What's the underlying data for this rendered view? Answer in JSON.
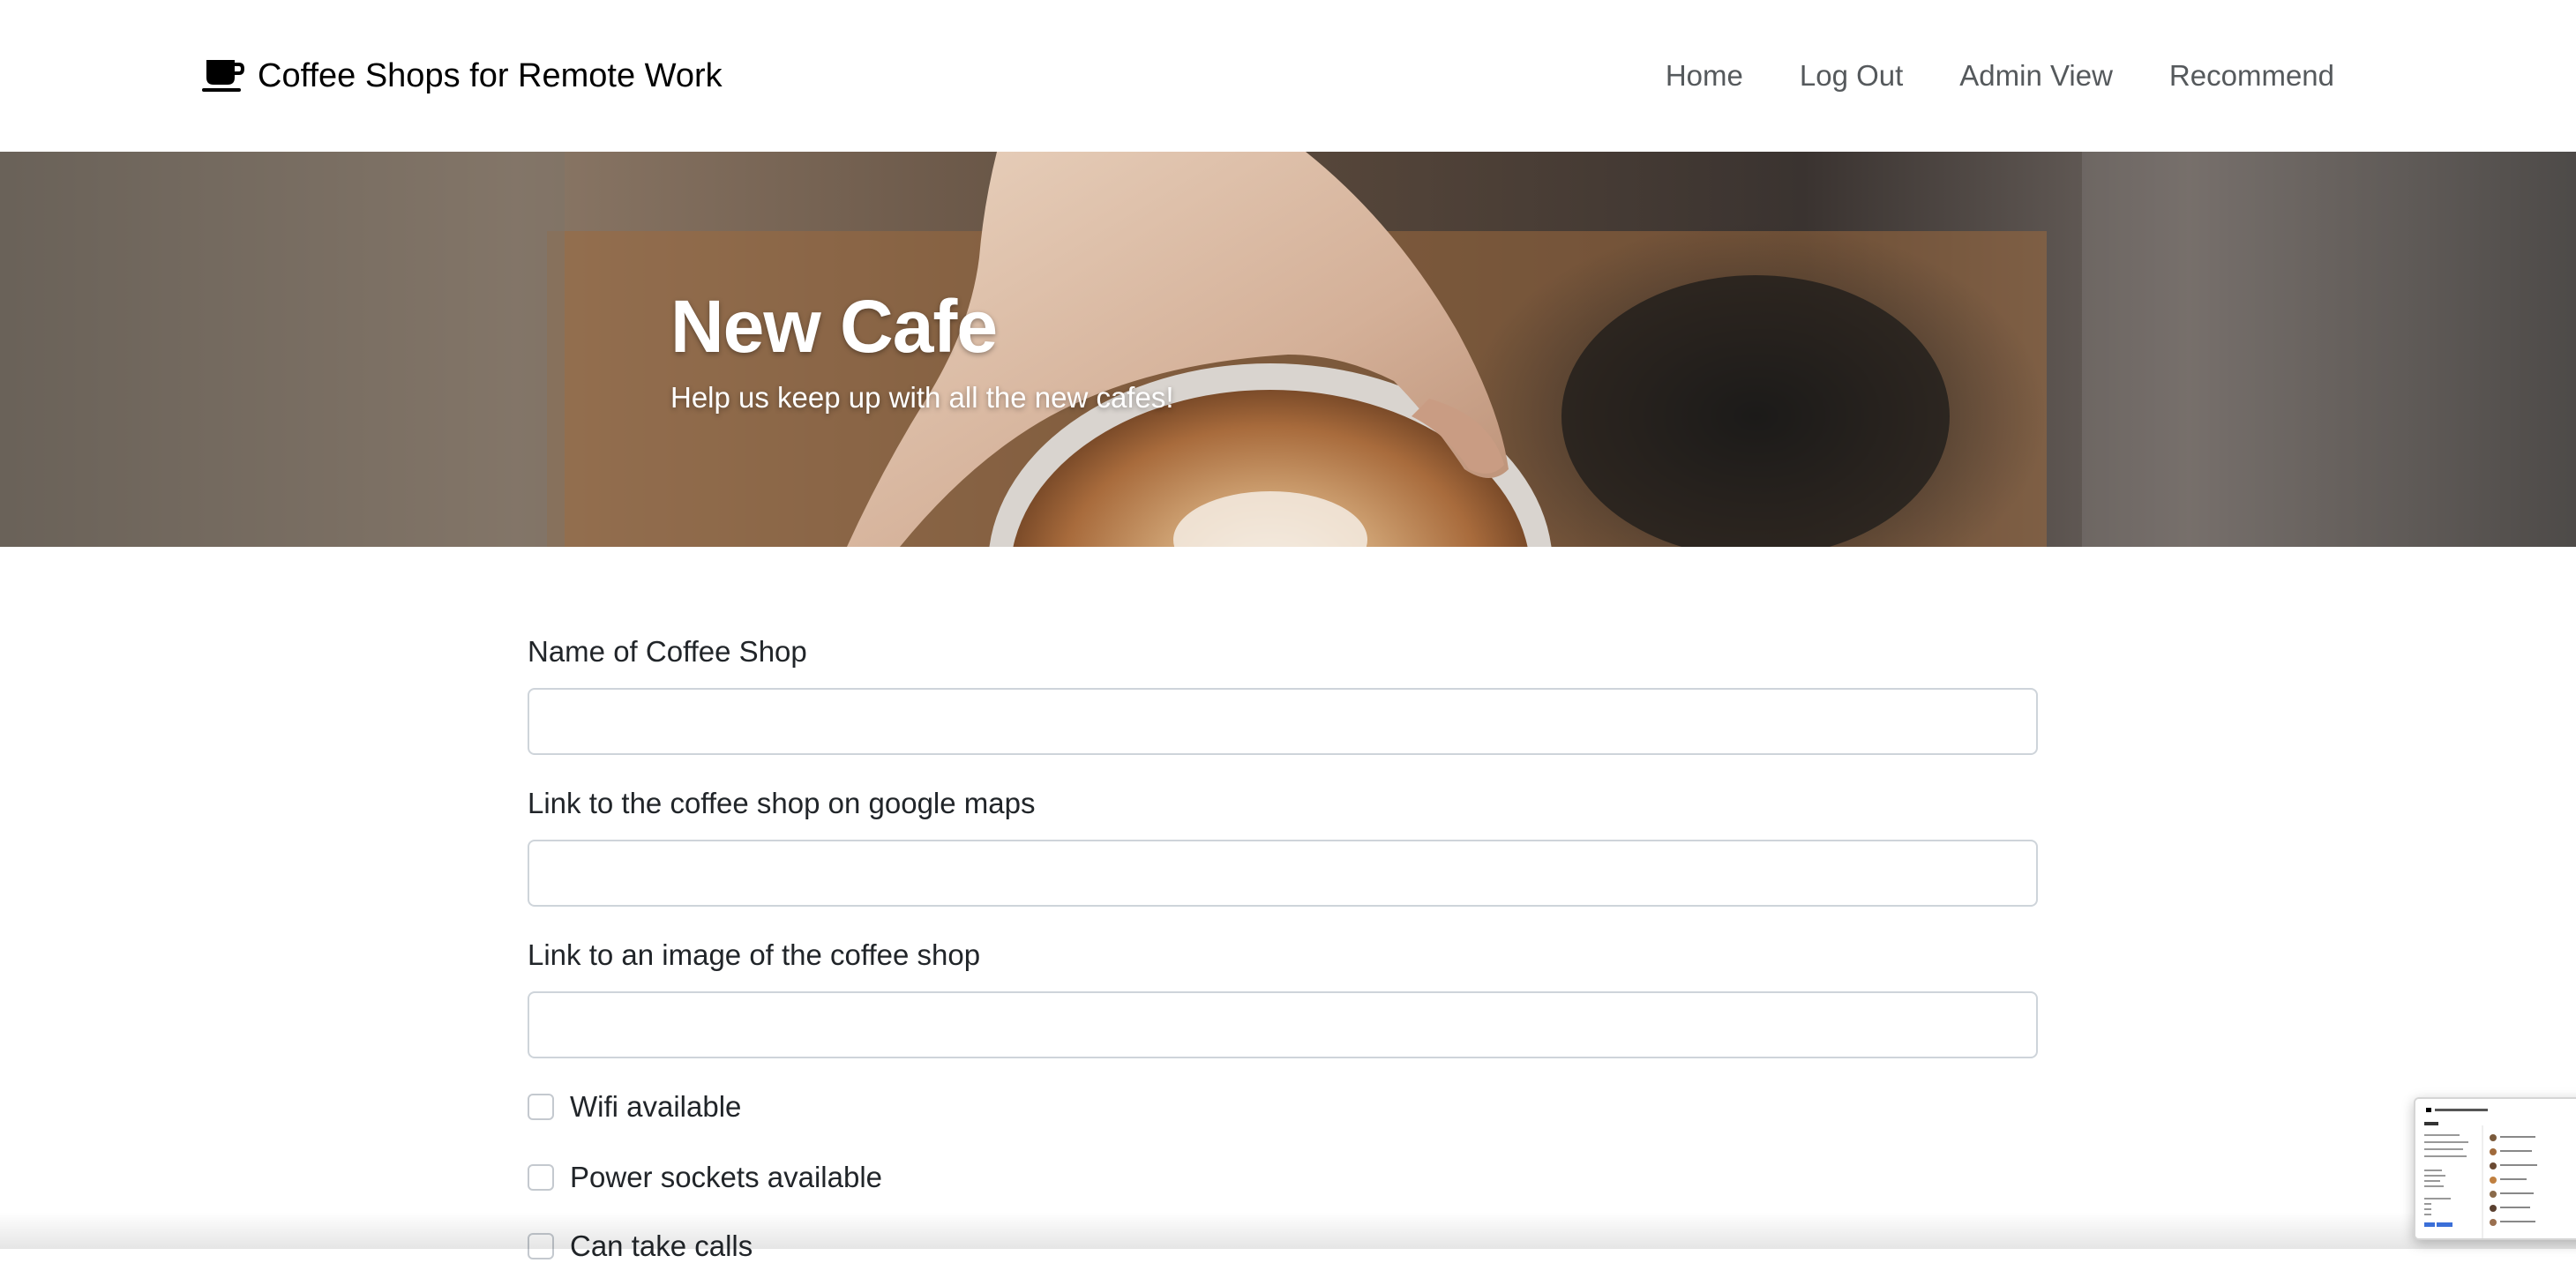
{
  "navbar": {
    "brand": "Coffee Shops for Remote Work",
    "brand_icon": "coffee-cup-icon",
    "links": [
      {
        "label": "Home"
      },
      {
        "label": "Log Out"
      },
      {
        "label": "Admin View"
      },
      {
        "label": "Recommend"
      }
    ]
  },
  "hero": {
    "title": "New Cafe",
    "subtitle": "Help us keep up with all the new cafes!"
  },
  "form": {
    "fields": [
      {
        "label": "Name of Coffee Shop",
        "value": ""
      },
      {
        "label": "Link to the coffee shop on google maps",
        "value": ""
      },
      {
        "label": "Link to an image of the coffee shop",
        "value": ""
      }
    ],
    "checkboxes": [
      {
        "label": "Wifi available",
        "checked": false
      },
      {
        "label": "Power sockets available",
        "checked": false
      },
      {
        "label": "Can take calls",
        "checked": false
      }
    ]
  },
  "colors": {
    "text": "#212529",
    "nav_link": "#55595c",
    "input_border": "#ced4da"
  }
}
